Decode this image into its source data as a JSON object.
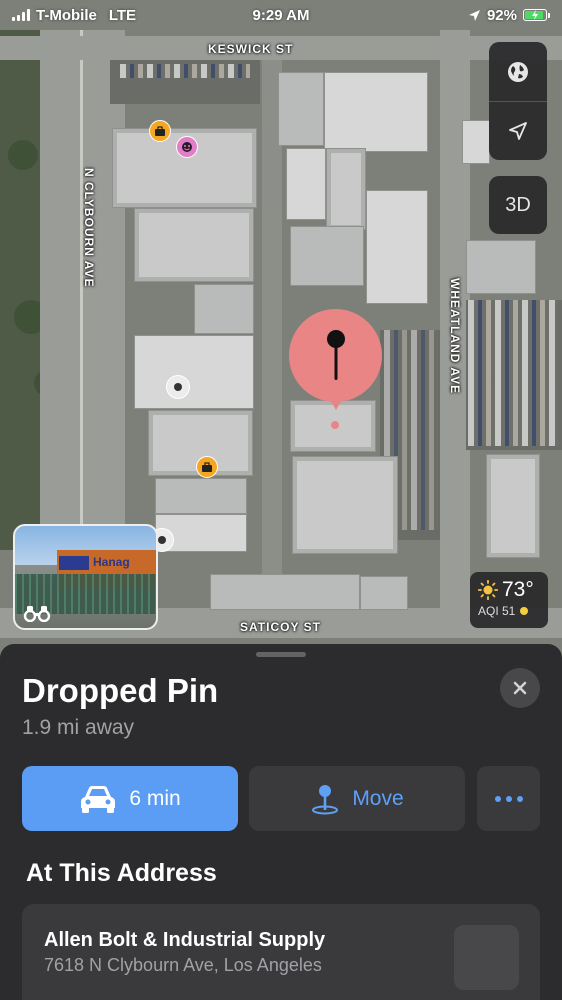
{
  "status_bar": {
    "carrier": "T-Mobile",
    "network": "LTE",
    "time": "9:29 AM",
    "battery_percent": "92%",
    "battery_level": 0.92,
    "icons": [
      "signal-bars-icon",
      "location-arrow-icon",
      "battery-charging-icon"
    ]
  },
  "map": {
    "street_labels": {
      "keswick": "KESWICK ST",
      "clybourn": "N CLYBOURN AVE",
      "wheatland": "WHEATLAND AVE",
      "saticoy": "SATICOY ST"
    },
    "controls": {
      "globe_icon": "globe-icon",
      "location_icon": "location-arrow-icon",
      "threed_label": "3D"
    },
    "lookaround": {
      "sign_text": "Hanag",
      "icon": "binoculars-icon"
    },
    "weather": {
      "temperature": "73°",
      "aqi": "AQI 51",
      "aqi_color": "#f4d03f",
      "icon": "sun-icon"
    },
    "pin_color": "#e98585"
  },
  "sheet": {
    "title": "Dropped Pin",
    "distance": "1.9 mi away",
    "actions": {
      "directions_label": "6 min",
      "move_label": "Move"
    },
    "section_title": "At This Address",
    "address_card": {
      "name": "Allen Bolt & Industrial Supply",
      "address": "7618 N Clybourn Ave, Los Angeles"
    },
    "accent_color": "#5b9cf5"
  }
}
